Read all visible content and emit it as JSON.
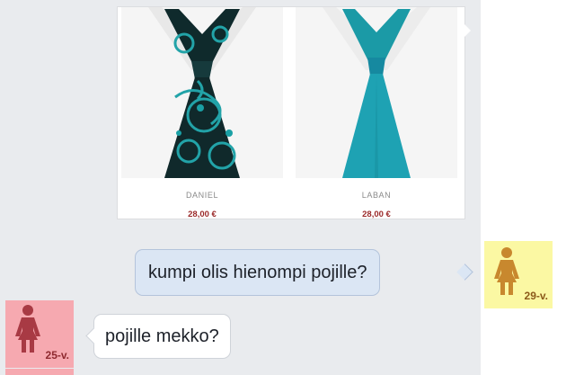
{
  "products": [
    {
      "name": "DANIEL",
      "price": "28,00 €"
    },
    {
      "name": "LABAN",
      "price": "28,00 €"
    }
  ],
  "messages": [
    {
      "text": "kumpi olis hienompi pojille?",
      "direction": "outgoing",
      "sender_age": "29-v."
    },
    {
      "text": "pojille mekko?",
      "direction": "incoming",
      "sender_age": "25-v."
    }
  ],
  "colors": {
    "chat_background": "#e9ebee",
    "outgoing_bubble": "#dbe6f4",
    "incoming_bubble": "#ffffff",
    "avatar_29": "#fbf8a3",
    "avatar_25": "#f6a9b0",
    "price": "#9b2a2a"
  },
  "icons": {
    "avatar": "female-figure-icon"
  }
}
